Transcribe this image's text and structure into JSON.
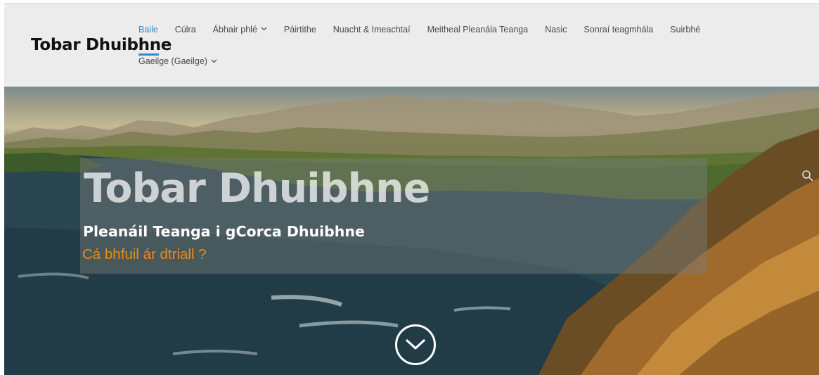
{
  "site": {
    "logo": "Tobar Dhuibhne"
  },
  "nav": {
    "items": [
      {
        "label": "Baile",
        "active": true,
        "dropdown": false
      },
      {
        "label": "Cúlra",
        "active": false,
        "dropdown": false
      },
      {
        "label": "Ábhair phlé",
        "active": false,
        "dropdown": true
      },
      {
        "label": "Páirtithe",
        "active": false,
        "dropdown": false
      },
      {
        "label": "Nuacht & Imeachtaí",
        "active": false,
        "dropdown": false
      },
      {
        "label": "Meitheal Pleanála Teanga",
        "active": false,
        "dropdown": false
      },
      {
        "label": "Nasic",
        "active": false,
        "dropdown": false
      },
      {
        "label": "Sonraí teagmhála",
        "active": false,
        "dropdown": false
      },
      {
        "label": "Suirbhé",
        "active": false,
        "dropdown": false
      }
    ],
    "language": {
      "label": "Gaeilge (Gaeilge)",
      "dropdown": true
    }
  },
  "hero": {
    "title": "Tobar Dhuibhne",
    "subtitle": "Pleanáil Teanga i gCorca Dhuibhne",
    "link": "Cá bhfuil ár dtriall ?"
  },
  "icons": {
    "down": "chevron-down-circle-icon",
    "search": "search-icon",
    "dropdown": "chevron-down-icon"
  },
  "colors": {
    "accent": "#2e8ccf",
    "link": "#f08a14",
    "header_bg": "#ececec"
  }
}
